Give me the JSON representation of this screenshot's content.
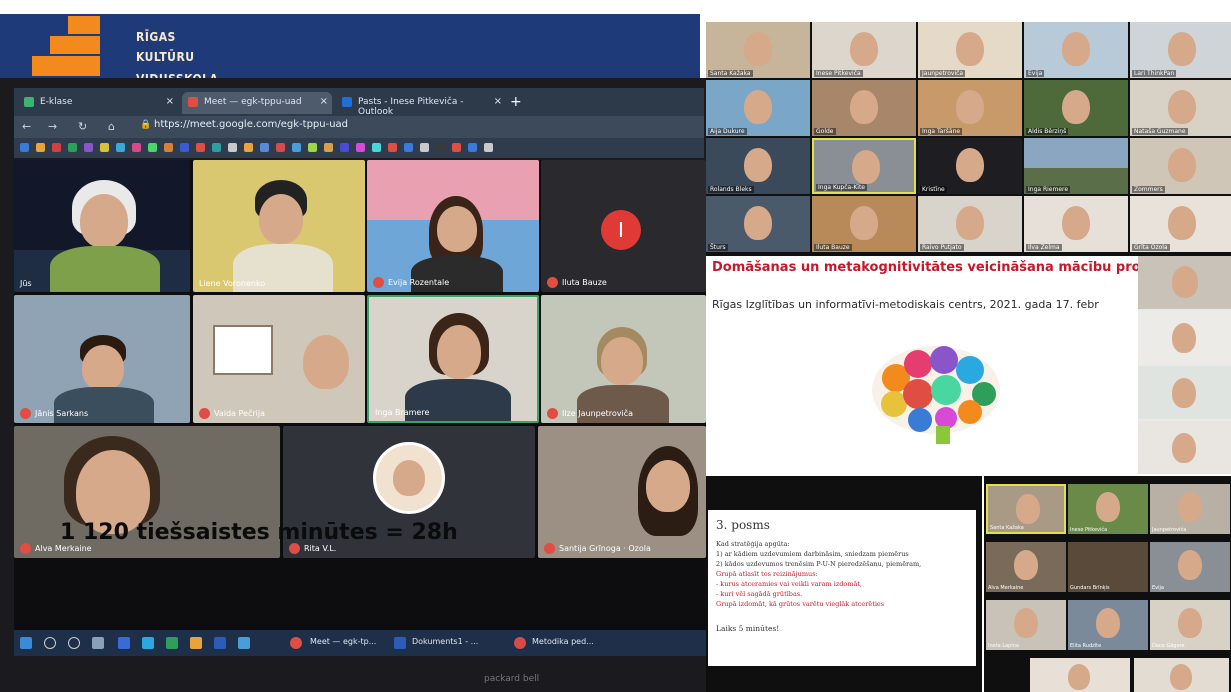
{
  "logo": {
    "line1": "RĪGAS",
    "line2": "KULTŪRU",
    "line3": "VIDUSSKOLA"
  },
  "browser": {
    "tabs": [
      {
        "label": "E-klase",
        "color": "#3cb371"
      },
      {
        "label": "Meet — egk-tppu-uad",
        "color": "#e04d43"
      },
      {
        "label": "Pasts - Inese Pitkeviča - Outlook",
        "color": "#1e6fd9"
      }
    ],
    "url": "https://meet.google.com/egk-tppu-uad"
  },
  "meet_tiles": [
    {
      "name": "Jūs"
    },
    {
      "name": "Liene Voronenko"
    },
    {
      "name": "Evija Rozentale"
    },
    {
      "name": "Iluta Bauze"
    },
    {
      "name": "Jānis Sarkans"
    },
    {
      "name": "Vaida Pečrija"
    },
    {
      "name": "Inga Bramere"
    },
    {
      "name": "Ilze Jaunpetroviča"
    },
    {
      "name": "Alva Merkaine"
    },
    {
      "name": "Rita V.L."
    },
    {
      "name": "Santija Grīnoga · Ozola"
    }
  ],
  "taskbar": {
    "item1": "Meet — egk-tp...",
    "item2": "Dokuments1 - ...",
    "item3": "Metodika ped..."
  },
  "monitor_brand": "packard bell",
  "caption": "1 120 tiešsaistes minūtes = 28h",
  "zoom_grid": [
    "Santa Kažaka",
    "Inese Pitkeviča",
    "Jaunpetroviča",
    "Evija",
    "Lari ThinkPan",
    "Aija Dukure",
    "Golde",
    "Inga Taršāne",
    "Aldis Bērziņš",
    "Nataša Guzmane",
    "Rolands Bleks",
    "Inga Kupča-Kīte",
    "Kristīne",
    "Inga Riemere",
    "Zommers",
    "Šturs",
    "Iluta Bauze",
    "Raivo Putjato",
    "Ilva Zelma",
    "Grīta Ozola"
  ],
  "slide1": {
    "title": "Domāšanas un metakognitivitātes veicināšana mācību proc",
    "subtitle": "Rīgas Izglītības un informatīvi-metodiskais centrs, 2021. gada 17. febr"
  },
  "slide2": {
    "title": "3. posms",
    "lines": [
      "Kad stratēģija apgūta:",
      "1)  ar kādiem uzdevumiem darbināsim, sniedzam piemērus",
      "2)  kādos uzdevumos trenēsim P-U-N pieredzēšanu, piemēram,"
    ],
    "red_lines": [
      "Grupā atlasīt tos reizinājumus:",
      "-  kurus atceramies vai veikli varam izdomāt,",
      "-  kuri vēl sagādā grūtības.",
      "Grupā izdomāt, kā grūtos varētu vieglāk atcerēties"
    ],
    "time": "Laiks 5 minūtes!"
  },
  "bottom_right_tiles": [
    "Santa Kažaka",
    "Inese Pitkeviča",
    "Jaunpetroviča",
    "Alva Merkaine",
    "Gundars Brīnķis",
    "Evija",
    "Ineta Lapiņa",
    "Elita Rudzīte",
    "Dace Gāgere"
  ]
}
